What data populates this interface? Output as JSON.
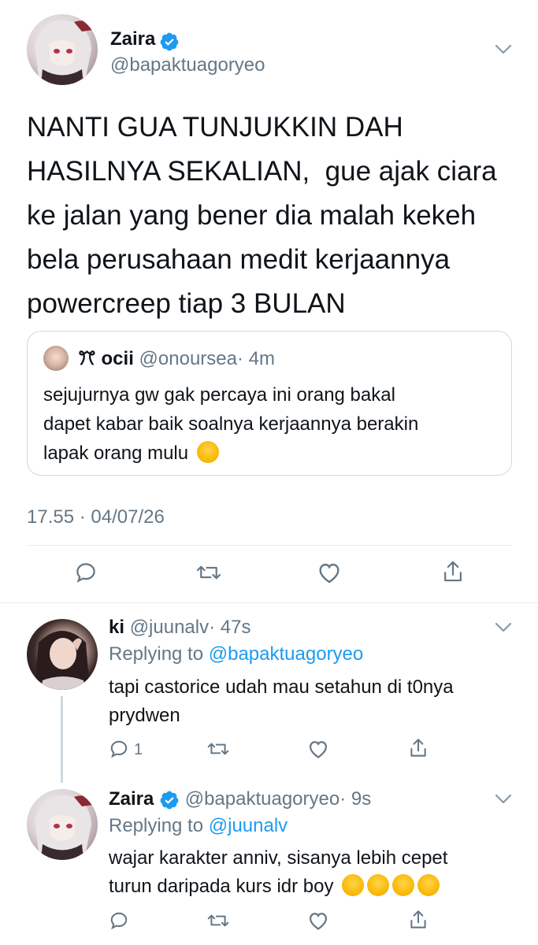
{
  "main_tweet": {
    "name": "Zaira",
    "handle": "@bapaktuagoryeo",
    "text_lines": [
      "NANTI GUA TUNJUKKIN DAH",
      "HASILNYA SEKALIAN,  gue ajak ciara",
      "ke jalan yang bener dia malah kekeh",
      "bela perusahaan medit kerjaannya",
      "powercreep tiap 3 BULAN"
    ],
    "timestamp": "17.55 · 04/07/26"
  },
  "quoted_tweet": {
    "name": "ꔫ ocii",
    "handle": "@onoursea",
    "time": "· 4m",
    "text_lines": [
      "sejujurnya gw gak percaya ini orang bakal",
      "dapet kabar baik soalnya kerjaannya berakin",
      "lapak orang mulu"
    ]
  },
  "reply1": {
    "name": "ki",
    "handle": "@juunalv",
    "time": "· 47s",
    "replying_prefix": "Replying to",
    "replying_to": "@bapaktuagoryeo",
    "text_lines": [
      "tapi castorice udah mau setahun di t0nya",
      "prydwen"
    ],
    "reply_count": "1"
  },
  "reply2": {
    "name": "Zaira",
    "handle": "@bapaktuagoryeo",
    "time": "· 9s",
    "replying_prefix": "Replying to",
    "replying_to": "@juunalv",
    "text_lines": [
      "wajar karakter anniv, sisanya lebih cepet",
      "turun daripada kurs idr boy"
    ]
  },
  "icons": {
    "reply": "reply-icon",
    "retweet": "retweet-icon",
    "like": "heart-icon",
    "share": "share-icon",
    "verified": "verified-badge-icon",
    "more": "chevron-down-icon"
  },
  "colors": {
    "link": "#1d9bf0",
    "secondary": "#657786",
    "verified": "#1d9bf0",
    "divider": "#e6ecf0"
  }
}
